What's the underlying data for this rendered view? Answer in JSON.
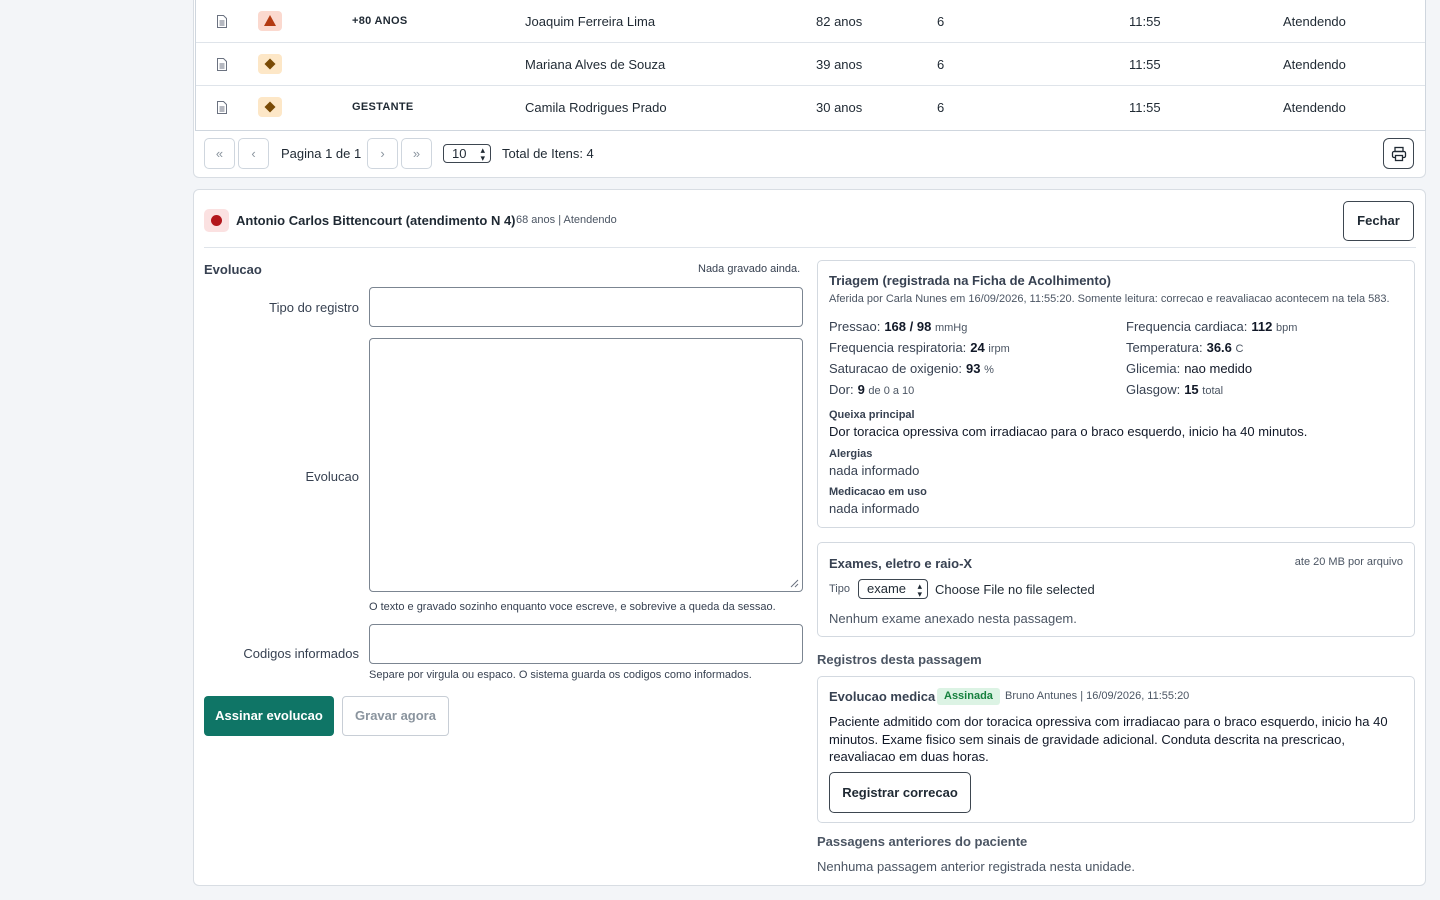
{
  "queue": {
    "rows": [
      {
        "priority": "red-triangle",
        "tag": "+80 ANOS",
        "name": "Joaquim Ferreira Lima",
        "age": "82 anos",
        "num": "6",
        "time": "11:55",
        "status": "Atendendo"
      },
      {
        "priority": "orange-diamond",
        "tag": "",
        "name": "Mariana Alves de Souza",
        "age": "39 anos",
        "num": "6",
        "time": "11:55",
        "status": "Atendendo"
      },
      {
        "priority": "orange-diamond",
        "tag": "GESTANTE",
        "name": "Camila Rodrigues Prado",
        "age": "30 anos",
        "num": "6",
        "time": "11:55",
        "status": "Atendendo"
      }
    ],
    "pager": {
      "first": "«",
      "prev": "‹",
      "next": "›",
      "last": "»",
      "page_label": "Pagina 1 de 1",
      "page_size": "10",
      "total": "Total de Itens: 4"
    }
  },
  "patient": {
    "name": "Antonio Carlos Bittencourt (atendimento N 4)",
    "sub": "68 anos | Atendendo",
    "close_label": "Fechar"
  },
  "evolution": {
    "title": "Evolucao",
    "saved_state": "Nada gravado ainda.",
    "type_label": "Tipo do registro",
    "type_value": "",
    "text_label": "Evolucao",
    "text_value": "",
    "text_help": "O texto e gravado sozinho enquanto voce escreve, e sobrevive a queda da sessao.",
    "codes_label": "Codigos informados",
    "codes_value": "",
    "codes_help": "Separe por virgula ou espaco. O sistema guarda os codigos como informados.",
    "sign_label": "Assinar evolucao",
    "save_label": "Gravar agora"
  },
  "triage": {
    "title": "Triagem (registrada na Ficha de Acolhimento)",
    "sub": "Aferida por Carla Nunes em 16/09/2026, 11:55:20. Somente leitura: correcao e reavaliacao acontecem na tela 583.",
    "vitals": [
      {
        "label": "Pressao:",
        "value": "168 / 98",
        "unit": "mmHg"
      },
      {
        "label": "Frequencia cardiaca:",
        "value": "112",
        "unit": "bpm"
      },
      {
        "label": "Frequencia respiratoria:",
        "value": "24",
        "unit": "irpm"
      },
      {
        "label": "Temperatura:",
        "value": "36.6",
        "unit": "C"
      },
      {
        "label": "Saturacao de oxigenio:",
        "value": "93",
        "unit": "%"
      },
      {
        "label": "Glicemia:",
        "value": "nao medido",
        "unit": ""
      },
      {
        "label": "Dor:",
        "value": "9",
        "unit": "de 0 a 10"
      },
      {
        "label": "Glasgow:",
        "value": "15",
        "unit": "total"
      }
    ],
    "complaint_h": "Queixa principal",
    "complaint": "Dor toracica opressiva com irradiacao para o braco esquerdo, inicio ha 40 minutos.",
    "allergies_h": "Alergias",
    "allergies": "nada informado",
    "meds_h": "Medicacao em uso",
    "meds": "nada informado"
  },
  "exams": {
    "title": "Exames, eletro e raio-X",
    "limit": "ate 20 MB por arquivo",
    "type_label": "Tipo",
    "type_value": "exame",
    "file_text": "Choose File no file selected",
    "none": "Nenhum exame anexado nesta passagem."
  },
  "records": {
    "title": "Registros desta passagem",
    "item_title": "Evolucao medica",
    "badge": "Assinada",
    "meta": "Bruno Antunes | 16/09/2026, 11:55:20",
    "text": "Paciente admitido com dor toracica opressiva com irradiacao para o braco esquerdo, inicio ha 40 minutos. Exame fisico sem sinais de gravidade adicional. Conduta descrita na prescricao, reavaliacao em duas horas.",
    "correct_label": "Registrar correcao"
  },
  "previous": {
    "title": "Passagens anteriores do paciente",
    "none": "Nenhuma passagem anterior registrada nesta unidade."
  },
  "colors": {
    "primary": "#0f7566",
    "danger": "#b3161b",
    "warning_bg": "#fde7c7",
    "success_bg": "#dcf3e4"
  }
}
